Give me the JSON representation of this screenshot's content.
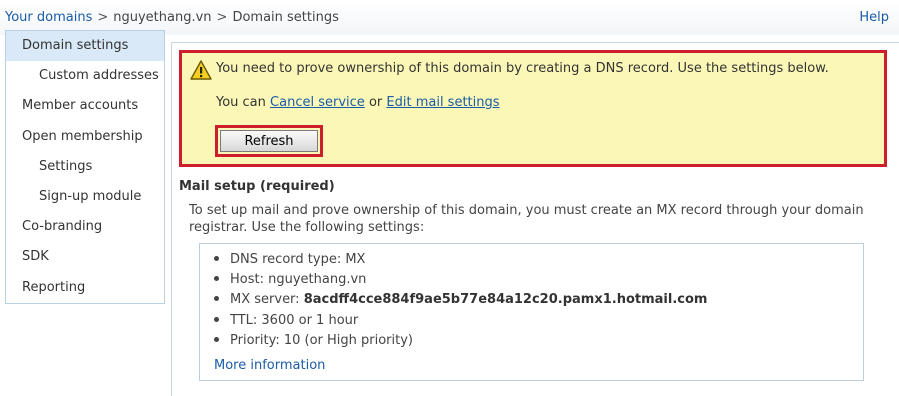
{
  "breadcrumb": {
    "your_domains": "Your domains",
    "separator": ">",
    "domain": "nguyethang.vn",
    "current": "Domain settings"
  },
  "help": "Help",
  "sidebar": {
    "items": [
      {
        "label": "Domain settings"
      },
      {
        "label": "Custom addresses"
      },
      {
        "label": "Member accounts"
      },
      {
        "label": "Open membership"
      },
      {
        "label": "Settings"
      },
      {
        "label": "Sign-up module"
      },
      {
        "label": "Co-branding"
      },
      {
        "label": "SDK"
      },
      {
        "label": "Reporting"
      }
    ]
  },
  "alert": {
    "icon": "warning-icon",
    "message": "You need to prove ownership of this domain by creating a DNS record. Use the settings below.",
    "you_can": "You can",
    "cancel_link": "Cancel service",
    "or": "or",
    "edit_link": "Edit mail settings",
    "refresh_label": "Refresh"
  },
  "mail_setup": {
    "title": "Mail setup (required)",
    "instructions": "To set up mail and prove ownership of this domain, you must create an MX record through your domain registrar. Use the following settings:",
    "dns_type": "DNS record type: MX",
    "host": "Host: nguyethang.vn",
    "mx_label": "MX server:",
    "mx_value": "8acdff4cce884f9ae5b77e84a12c20.pamx1.hotmail.com",
    "ttl": "TTL: 3600 or 1 hour",
    "priority": "Priority: 10 (or High priority)",
    "more_info": "More information"
  },
  "colors": {
    "link": "#1a5ca8",
    "alert_bg": "#fbf8b7",
    "highlight_border": "#cd1e2c",
    "active_nav": "#d9e9f7"
  }
}
